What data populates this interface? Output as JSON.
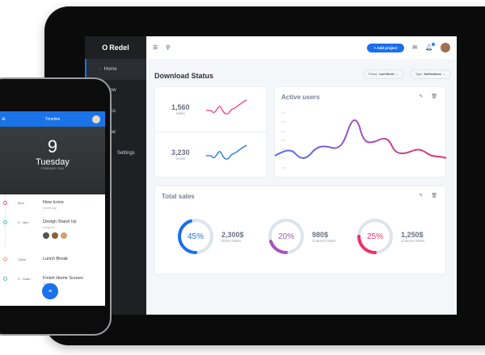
{
  "app": {
    "logo": "Redel"
  },
  "sidebar": {
    "items": [
      {
        "label": "Home"
      },
      {
        "label": "Workflow"
      },
      {
        "label": "Statistics"
      },
      {
        "label": "Calendar"
      },
      {
        "label": "Settings"
      }
    ]
  },
  "header": {
    "add_project": "+ Add project",
    "notification_count": "1"
  },
  "main": {
    "title": "Download Status",
    "filters": [
      {
        "label": "Period:",
        "value": "Last Month"
      },
      {
        "label": "Type:",
        "value": "Notifications"
      }
    ],
    "stats": [
      {
        "value": "1,560",
        "label": "Sales",
        "color": "#f0407a"
      },
      {
        "value": "3,230",
        "label": "Views",
        "color": "#1a73e8"
      }
    ],
    "active_users": {
      "title": "Active users",
      "y_ticks": [
        "700",
        "600",
        "500",
        "400",
        "300",
        "200",
        "100"
      ]
    },
    "total_sales": {
      "title": "Total sales",
      "items": [
        {
          "percent": "45%",
          "amount": "2,300$",
          "label": "Direct Sales",
          "color": "#1a6ff0",
          "fraction": 0.45
        },
        {
          "percent": "20%",
          "amount": "980$",
          "label": "Channel Sales",
          "color": "#a855b8",
          "fraction": 0.2
        },
        {
          "percent": "25%",
          "amount": "1,250$",
          "label": "Channel Sales",
          "color": "#f0306a",
          "fraction": 0.25
        }
      ]
    }
  },
  "phone": {
    "title": "Timeline",
    "day": "9",
    "weekday": "Tuesday",
    "month": "FEBRUARY 2015",
    "events": [
      {
        "time": "5pm",
        "name": "New Icons",
        "sub": "Mobile App",
        "color": "#f0507a"
      },
      {
        "time": "3 - 4pm",
        "name": "Design Stand Up",
        "sub": "Hangouts",
        "color": "#3cc8b4"
      },
      {
        "time": "12pm",
        "name": "Lunch Break",
        "sub": "",
        "color": "#f59070"
      },
      {
        "time": "9 - 11am",
        "name": "Finish Home Screen",
        "sub": "Web App",
        "color": "#3cc8b4"
      }
    ]
  }
}
